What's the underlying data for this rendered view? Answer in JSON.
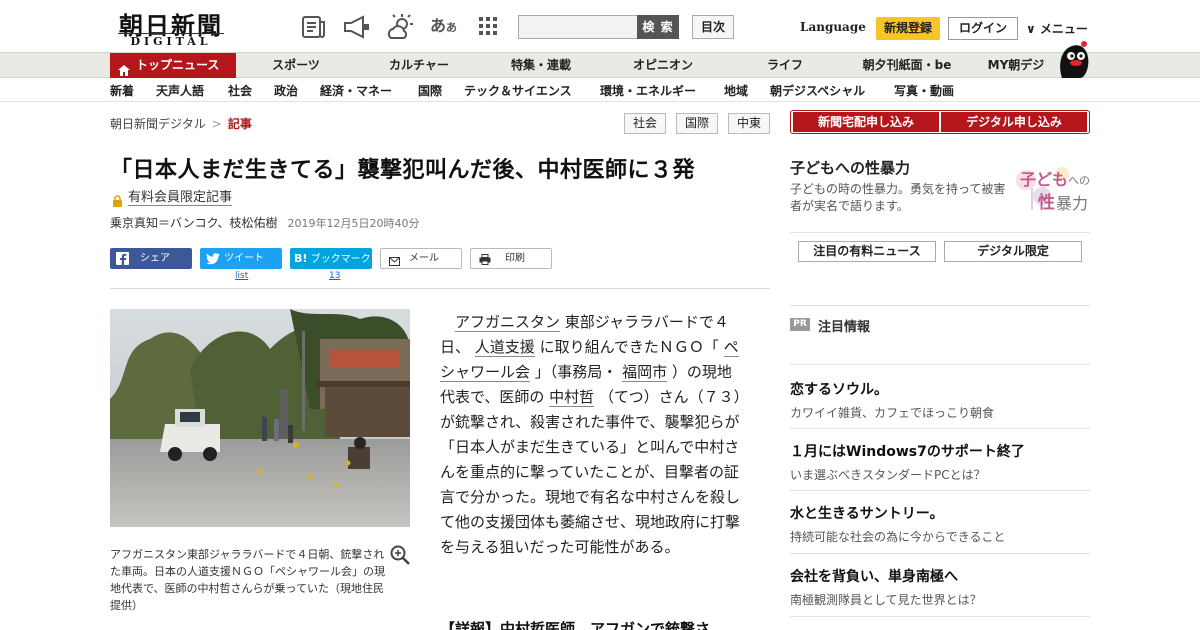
{
  "header": {
    "logo_main": "朝日新聞",
    "logo_sub": "DIGITAL",
    "search_placeholder": "",
    "search_button": "検 索",
    "toc_button": "目次",
    "language": "Language",
    "register": "新規登録",
    "login": "ログイン",
    "menu": "∨ メニュー"
  },
  "nav_primary": [
    "トップニュース",
    "スポーツ",
    "カルチャー",
    "特集・連載",
    "オピニオン",
    "ライフ",
    "朝夕刊紙面・be",
    "MY朝デジ"
  ],
  "nav_secondary": [
    "新着",
    "天声人語",
    "社会",
    "政治",
    "経済・マネー",
    "国際",
    "テック＆サイエンス",
    "環境・エネルギー",
    "地域",
    "朝デジスペシャル",
    "写真・動画"
  ],
  "breadcrumb": {
    "home": "朝日新聞デジタル",
    "separator": ">",
    "current": "記事"
  },
  "tags": [
    "社会",
    "国際",
    "中東"
  ],
  "article": {
    "title": "「日本人まだ生きてる」襲撃犯叫んだ後、中村医師に３発",
    "members_label": "有料会員限定記事",
    "author": "乗京真知＝バンコク、枝松佑樹",
    "date": "2019年12月5日20時40分",
    "share": {
      "facebook": "シェア",
      "tweet": "ツイート",
      "tweet_sub": "list",
      "hatena": "ブックマーク",
      "hatena_sub": "13",
      "mail": "メール",
      "print": "印刷"
    },
    "caption": "アフガニスタン東部ジャララバードで４日朝、銃撃された車両。日本の人道支援ＮＧＯ「ペシャワール会」の現地代表で、医師の中村哲さんらが乗っていた（現地住民提供）",
    "body": {
      "p1": "　",
      "l1": "アフガニスタン",
      "p2": " 東部ジャララバードで４日、 ",
      "l2": "人道支援",
      "p3": " に取り組んできたＮＧＯ「 ",
      "l3": "ペシャワール会",
      "p4": " 」（事務局・ ",
      "l4": "福岡市",
      "p5": " ）の現地代表で、医師の ",
      "l5": "中村哲",
      "p6": " （てつ）さん（７３）が銃撃され、殺害された事件で、襲撃犯らが「日本人がまだ生きている」と叫んで中村さんを重点的に撃っていたことが、目撃者の証言で分かった。現地で有名な中村さんを殺して他の支援団体も萎縮させ、現地政府に打撃を与える狙いだった可能性がある。"
    },
    "related": "【詳報】中村哲医師、アフガンで銃撃さ"
  },
  "sidebar": {
    "subscribe_paper": "新聞宅配申し込み",
    "subscribe_digital": "デジタル申し込み",
    "feature_title": "子どもへの性暴力",
    "feature_desc": "子どもの時の性暴力。勇気を持って被害者が実名で語ります。",
    "feature_logo_line1": "子ども",
    "feature_logo_line1b": "への",
    "feature_logo_line2a": "性",
    "feature_logo_line2b": "暴力",
    "btn_paid_news": "注目の有料ニュース",
    "btn_digital_only": "デジタル限定",
    "pr_badge": "PR",
    "pr_title": "注目情報",
    "pr_items": [
      {
        "title": "恋するソウル。",
        "desc": "カワイイ雑貨、カフェでほっこり朝食"
      },
      {
        "title": "１月にはWindows7のサポート終了",
        "desc": "いま選ぶべきスタンダードPCとは？"
      },
      {
        "title": "水と生きるサントリー。",
        "desc": "持続可能な社会の為に今からできること"
      },
      {
        "title": "会社を背負い、単身南極へ",
        "desc": "南極観測隊員として見た世界とは？"
      }
    ]
  },
  "colors": {
    "brand_red": "#b4161b",
    "register_yellow": "#f7c526",
    "facebook": "#3b5998",
    "twitter": "#1da1f2",
    "hatena": "#00a4de"
  }
}
